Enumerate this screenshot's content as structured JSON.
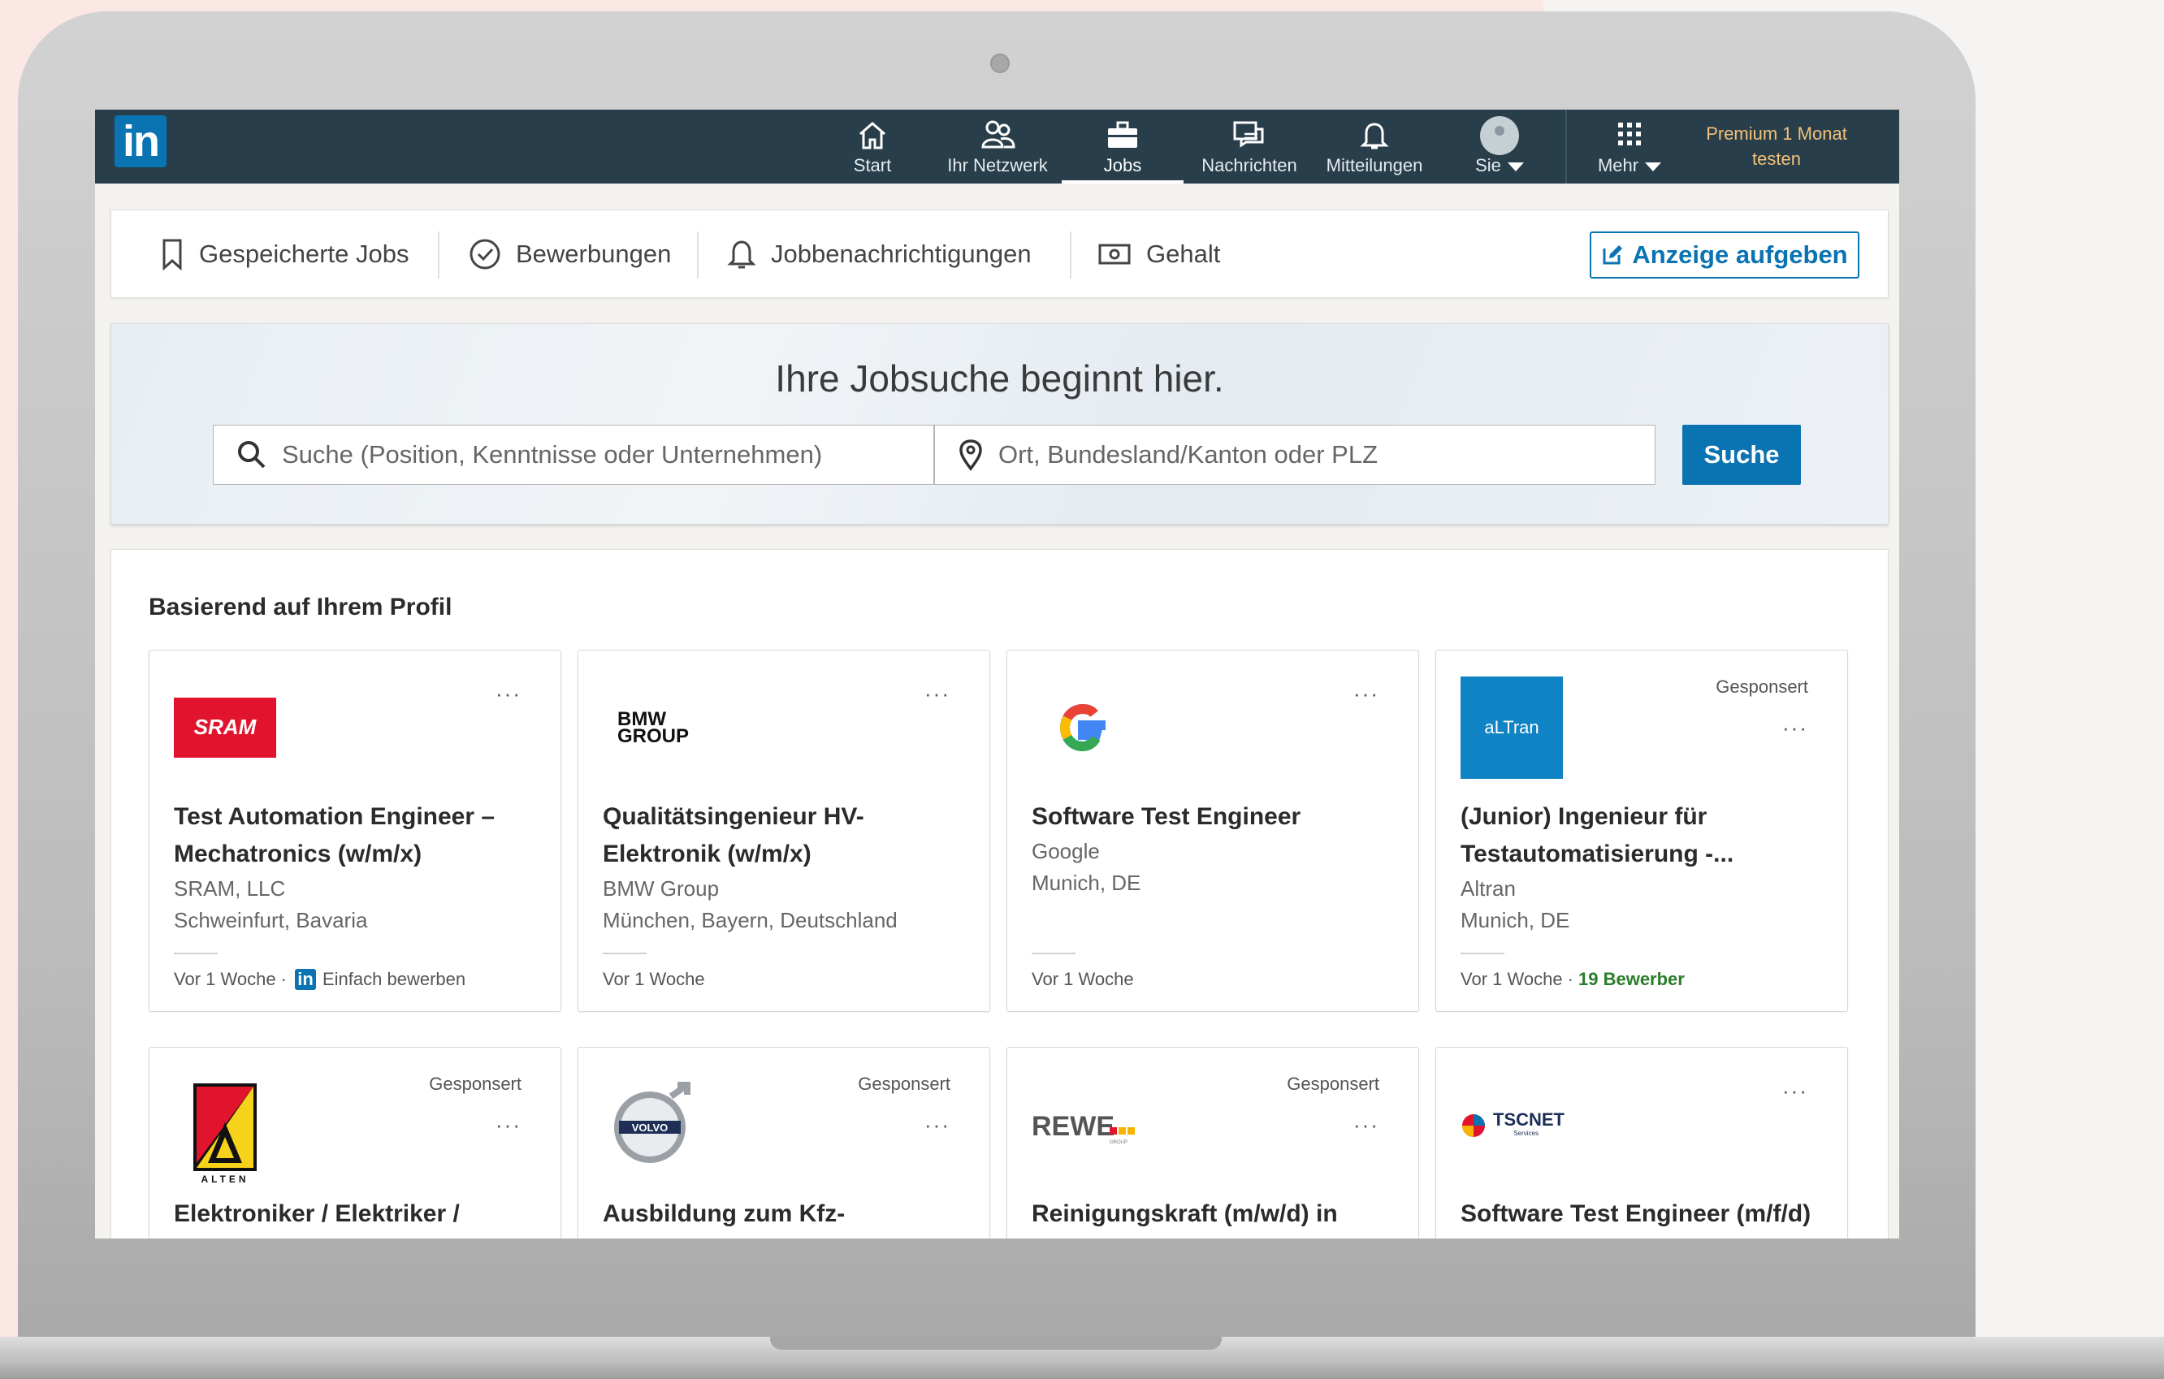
{
  "nav": {
    "logo": "in",
    "items": [
      {
        "label": "Start"
      },
      {
        "label": "Ihr Netzwerk"
      },
      {
        "label": "Jobs"
      },
      {
        "label": "Nachrichten"
      },
      {
        "label": "Mitteilungen"
      },
      {
        "label": "Sie"
      },
      {
        "label": "Mehr"
      }
    ],
    "premium_line1": "Premium 1 Monat",
    "premium_line2": "testen"
  },
  "subbar": {
    "tabs": [
      {
        "label": "Gespeicherte Jobs",
        "icon": "bookmark-icon"
      },
      {
        "label": "Bewerbungen",
        "icon": "check-circle-icon"
      },
      {
        "label": "Jobbenachrichtigungen",
        "icon": "bell-icon"
      },
      {
        "label": "Gehalt",
        "icon": "money-icon"
      }
    ],
    "post_job": "Anzeige aufgeben"
  },
  "search": {
    "headline": "Ihre Jobsuche beginnt hier.",
    "keyword_placeholder": "Suche (Position, Kenntnisse oder Unternehmen)",
    "location_placeholder": "Ort, Bundesland/Kanton oder PLZ",
    "button": "Suche"
  },
  "results": {
    "title": "Basierend auf Ihrem Profil",
    "cards": [
      {
        "title_line1": "Test Automation Engineer –",
        "title_line2": "Mechatronics (w/m/x)",
        "company": "SRAM, LLC",
        "location": "Schweinfurt, Bavaria",
        "posted": "Vor 1 Woche ·",
        "easy_apply": "Einfach bewerben",
        "logo_text": "SRAM"
      },
      {
        "title_line1": "Qualitätsingenieur HV-",
        "title_line2": "Elektronik (w/m/x)",
        "company": "BMW Group",
        "location": "München, Bayern, Deutschland",
        "posted": "Vor 1 Woche",
        "logo_text_1": "BMW",
        "logo_text_2": "GROUP"
      },
      {
        "title_line1": "Software Test Engineer",
        "company": "Google",
        "location": "Munich, DE",
        "posted": "Vor 1 Woche",
        "logo_text": "G"
      },
      {
        "title_line1": "(Junior) Ingenieur für",
        "title_line2": "Testautomatisierung -...",
        "company": "Altran",
        "location": "Munich, DE",
        "posted": "Vor 1 Woche ·",
        "applicants": "19 Bewerber",
        "sponsored": "Gesponsert",
        "logo_text": "aLTran"
      }
    ],
    "cards_row2": [
      {
        "title_line1": "Elektroniker / Elektriker /",
        "sponsored": "Gesponsert",
        "logo_text": "ALTEN"
      },
      {
        "title_line1": "Ausbildung zum Kfz-",
        "sponsored": "Gesponsert",
        "logo_text": "VOLVO"
      },
      {
        "title_line1": "Reinigungskraft (m/w/d) in",
        "sponsored": "Gesponsert",
        "logo_text": "REWE",
        "logo_sub": "GROUP"
      },
      {
        "title_line1": "Software Test Engineer (m/f/d)",
        "logo_text": "TSCNET",
        "logo_sub": "Services"
      }
    ],
    "more_label": "···"
  }
}
